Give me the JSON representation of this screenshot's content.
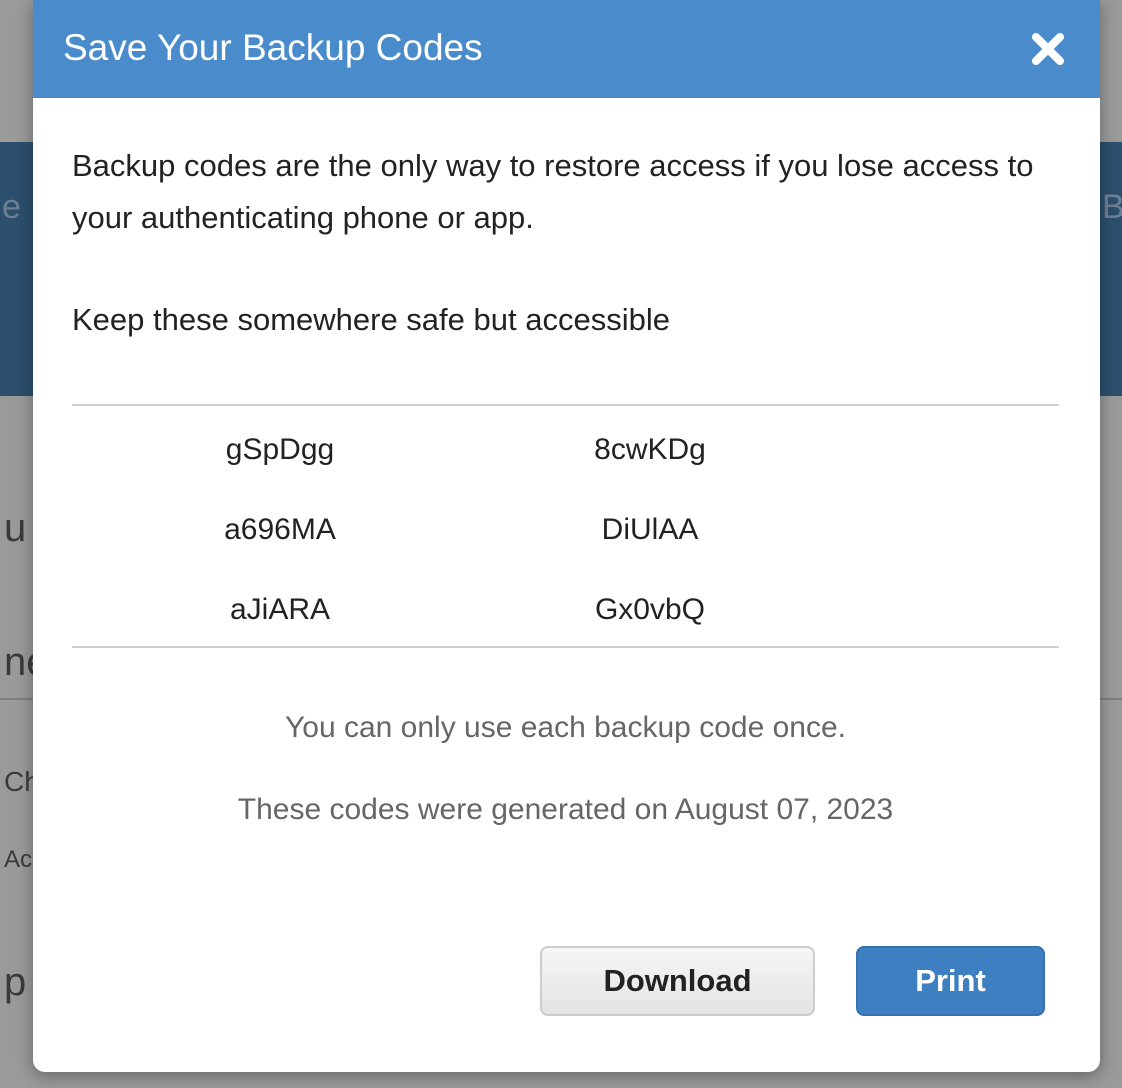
{
  "background": {
    "fragments": [
      "e",
      "Bu",
      "u",
      "ne",
      "Ch",
      "Ac",
      "p"
    ]
  },
  "modal": {
    "title": "Save Your Backup Codes",
    "close_icon": "close-icon",
    "intro": "Backup codes are the only way to restore access if you lose access to your authenticating phone or app.",
    "keep": "Keep these somewhere safe but accessible",
    "codes": [
      [
        "gSpDgg",
        "8cwKDg"
      ],
      [
        "a696MA",
        "DiUlAA"
      ],
      [
        "aJiARA",
        "Gx0vbQ"
      ]
    ],
    "once_note": "You can only use each backup code once.",
    "generated_note": "These codes were generated on August 07, 2023",
    "download_label": "Download",
    "print_label": "Print"
  },
  "colors": {
    "header": "#4a8ccb",
    "primary_button": "#3e7fc1",
    "background_band": "#2c4f6e"
  }
}
